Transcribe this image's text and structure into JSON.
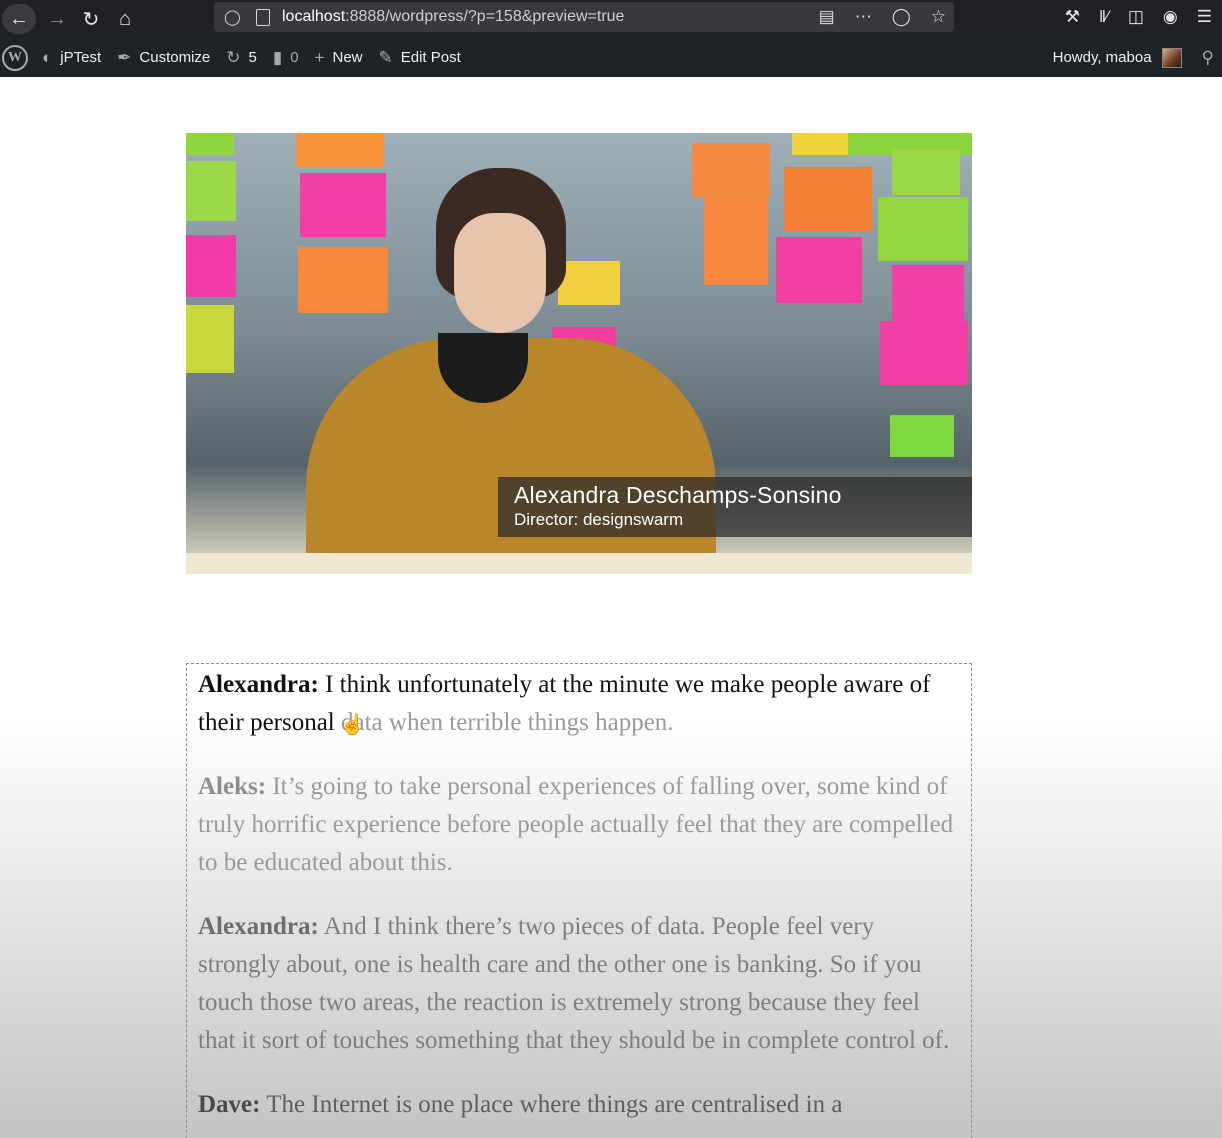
{
  "browser": {
    "url_host": "localhost",
    "url_rest": ":8888/wordpress/?p=158&preview=true"
  },
  "admin_bar": {
    "site_name": "jPTest",
    "customize": "Customize",
    "updates_count": "5",
    "comments_count": "0",
    "new_label": "New",
    "edit_post": "Edit Post",
    "howdy": "Howdy, maboa"
  },
  "video": {
    "caption_name": "Alexandra Deschamps-Sonsino",
    "caption_role": "Director: designswarm"
  },
  "transcript": [
    {
      "speaker": "Alexandra:",
      "text": " I think unfortunately at the minute we make people aware of their personal",
      "faded": " data when terrible things happen."
    },
    {
      "speaker": "Aleks:",
      "text": " It’s going to take personal experiences of falling over, some kind of truly horrific experience before people actually feel that they are compelled to be educated about this."
    },
    {
      "speaker": "Alexandra:",
      "text": " And I think there’s two pieces of data. People feel very strongly about, one is health care and the other one is banking. So if you touch those two areas, the reaction is extremely strong because they feel that it sort of touches something that they should be in complete control of."
    },
    {
      "speaker": "Dave:",
      "text": " The Internet is one place where things are centralised in a"
    }
  ]
}
